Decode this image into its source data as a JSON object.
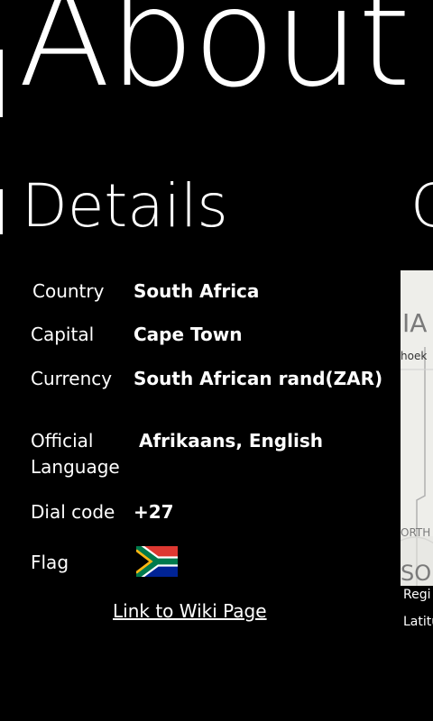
{
  "panorama": {
    "title": "About",
    "section_title": "Details",
    "next_section_title_fragment": "C"
  },
  "details": [
    {
      "label": "Country",
      "value": "South Africa"
    },
    {
      "label": "Capital",
      "value": "Cape Town"
    },
    {
      "label": "Currency",
      "value": "South African rand(ZAR)"
    },
    {
      "label_line1": "Official",
      "label_line2": "Language",
      "value": "Afrikaans, English"
    },
    {
      "label": "Dial code",
      "value": "+27"
    },
    {
      "label": "Flag"
    }
  ],
  "flag_icon": "south-africa-flag",
  "wiki_link": "Link to Wiki Page",
  "map_preview": {
    "text_fragments": [
      "IA",
      "hoek",
      "ORTH",
      "SO"
    ],
    "region_label_fragment": "Regi",
    "latitude_label_fragment": "Latitu"
  }
}
